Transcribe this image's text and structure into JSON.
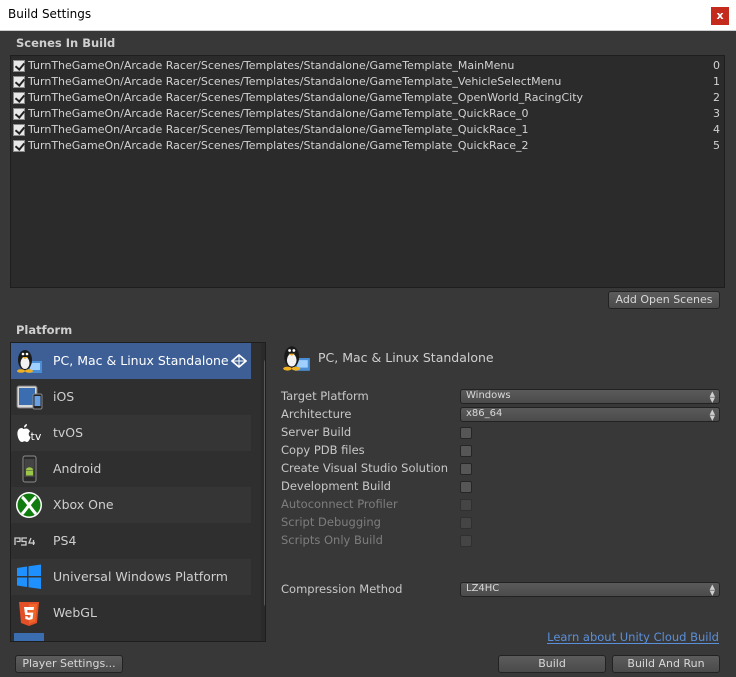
{
  "window": {
    "title": "Build Settings",
    "close_label": "x"
  },
  "scenes": {
    "heading": "Scenes In Build",
    "items": [
      {
        "path": "TurnTheGameOn/Arcade Racer/Scenes/Templates/Standalone/GameTemplate_MainMenu",
        "index": "0"
      },
      {
        "path": "TurnTheGameOn/Arcade Racer/Scenes/Templates/Standalone/GameTemplate_VehicleSelectMenu",
        "index": "1"
      },
      {
        "path": "TurnTheGameOn/Arcade Racer/Scenes/Templates/Standalone/GameTemplate_OpenWorld_RacingCity",
        "index": "2"
      },
      {
        "path": "TurnTheGameOn/Arcade Racer/Scenes/Templates/Standalone/GameTemplate_QuickRace_0",
        "index": "3"
      },
      {
        "path": "TurnTheGameOn/Arcade Racer/Scenes/Templates/Standalone/GameTemplate_QuickRace_1",
        "index": "4"
      },
      {
        "path": "TurnTheGameOn/Arcade Racer/Scenes/Templates/Standalone/GameTemplate_QuickRace_2",
        "index": "5"
      }
    ],
    "add_open_scenes_label": "Add Open Scenes"
  },
  "platform": {
    "heading": "Platform",
    "items": [
      {
        "label": "PC, Mac & Linux Standalone",
        "icon": "tux-icon"
      },
      {
        "label": "iOS",
        "icon": "ipad-icon"
      },
      {
        "label": "tvOS",
        "icon": "apple-tv-icon"
      },
      {
        "label": "Android",
        "icon": "android-phone-icon"
      },
      {
        "label": "Xbox One",
        "icon": "xbox-icon"
      },
      {
        "label": "PS4",
        "icon": "ps4-icon"
      },
      {
        "label": "Universal Windows Platform",
        "icon": "windows-icon"
      },
      {
        "label": "WebGL",
        "icon": "html5-icon"
      }
    ]
  },
  "settings": {
    "title": "PC, Mac & Linux Standalone",
    "target_platform": {
      "label": "Target Platform",
      "value": "Windows"
    },
    "architecture": {
      "label": "Architecture",
      "value": "x86_64"
    },
    "server_build": "Server Build",
    "copy_pdb": "Copy PDB files",
    "create_vs": "Create Visual Studio Solution",
    "development_build": "Development Build",
    "autoconnect_profiler": "Autoconnect Profiler",
    "script_debugging": "Script Debugging",
    "scripts_only_build": "Scripts Only Build",
    "compression": {
      "label": "Compression Method",
      "value": "LZ4HC"
    }
  },
  "footer": {
    "cloud_link": "Learn about Unity Cloud Build",
    "player_settings_label": "Player Settings...",
    "build_label": "Build",
    "build_and_run_label": "Build And Run"
  },
  "colors": {
    "selection": "#3d5f96",
    "link": "#5b8fd9",
    "close": "#c42b1c"
  }
}
